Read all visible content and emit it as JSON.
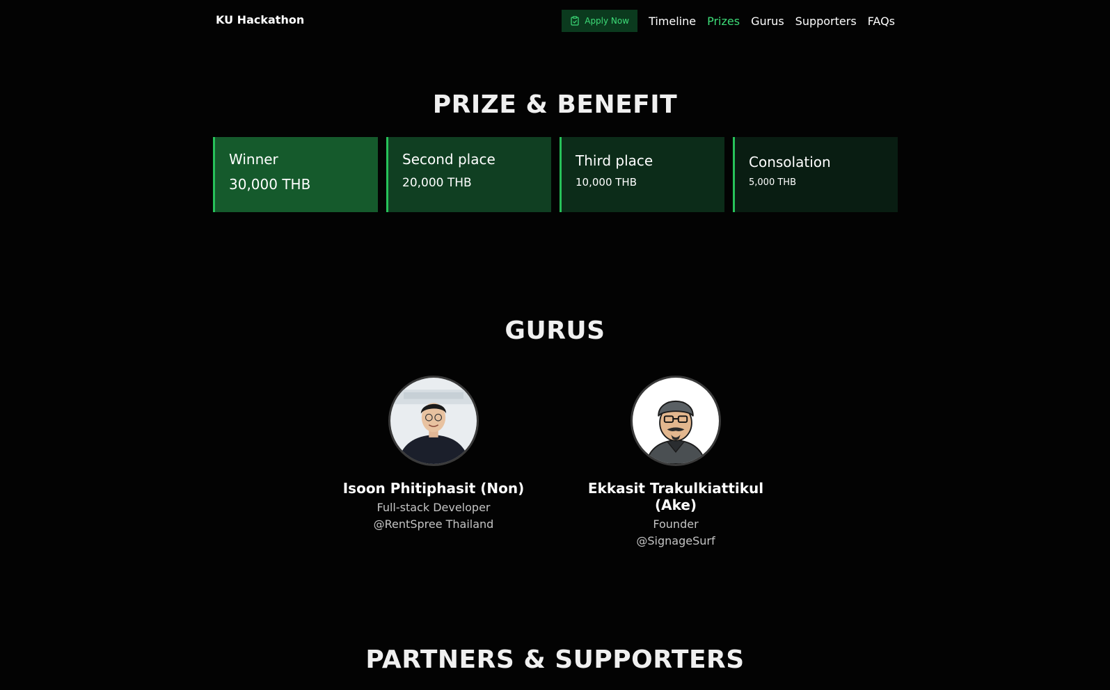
{
  "nav": {
    "brand": "KU Hackathon",
    "apply_label": "Apply Now",
    "links": [
      {
        "label": "Timeline",
        "active": false
      },
      {
        "label": "Prizes",
        "active": true
      },
      {
        "label": "Gurus",
        "active": false
      },
      {
        "label": "Supporters",
        "active": false
      },
      {
        "label": "FAQs",
        "active": false
      }
    ]
  },
  "prizes": {
    "title": "PRIZE & BENEFIT",
    "cards": [
      {
        "label": "Winner",
        "amount": "30,000 THB"
      },
      {
        "label": "Second place",
        "amount": "20,000 THB"
      },
      {
        "label": "Third place",
        "amount": "10,000 THB"
      },
      {
        "label": "Consolation",
        "amount": "5,000 THB"
      }
    ]
  },
  "gurus": {
    "title": "GURUS",
    "people": [
      {
        "name": "Isoon Phitiphasit (Non)",
        "role": "Full-stack Developer",
        "company": "@RentSpree Thailand"
      },
      {
        "name": "Ekkasit Trakulkiattikul (Ake)",
        "role": "Founder",
        "company": "@SignageSurf"
      }
    ]
  },
  "partners": {
    "title": "PARTNERS & SUPPORTERS"
  },
  "colors": {
    "accent": "#3ddc78",
    "background": "#030303",
    "card_border": "#27c25a"
  },
  "icons": {
    "apply": "clipboard-check-icon"
  }
}
